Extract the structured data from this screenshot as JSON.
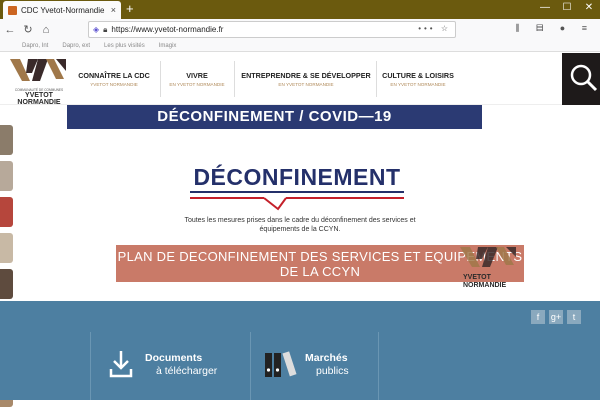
{
  "browser": {
    "tab_title": "CDC Yvetot-Normandie",
    "tab_close": "×",
    "new_tab": "+",
    "url": "https://www.yvetot-normandie.fr",
    "url_actions": "••• ☆",
    "window_controls": [
      "—",
      "☐",
      "✕"
    ],
    "nav_icons": [
      "←",
      "↻",
      "⌂"
    ],
    "bookmarks": [
      "Dapro, Int",
      "Dapro, ext",
      "Les plus visités",
      "Imagix"
    ],
    "colors": {
      "titlebar": "#6b5a0e"
    }
  },
  "header": {
    "logo": {
      "text_top": "COMMUNAUTÉ DE COMMUNES",
      "text_bottom_1": "YVETOT",
      "text_bottom_2": "NORMANDIE"
    },
    "menu": [
      {
        "title": "CONNAÎTRE LA CDC",
        "subtitle": "YVETOT NORMANDIE"
      },
      {
        "title": "VIVRE",
        "subtitle": "EN YVETOT NORMANDIE"
      },
      {
        "title": "ENTREPRENDRE & SE DÉVELOPPER",
        "subtitle": "EN YVETOT NORMANDIE"
      },
      {
        "title": "CULTURE & LOISIRS",
        "subtitle": "EN YVETOT NORMANDIE"
      }
    ]
  },
  "main": {
    "banner_title": "DÉCONFINEMENT / COVID—19",
    "deco_title": "DÉCONFINEMENT",
    "description": "Toutes les mesures prises dans le cadre du déconfinement des services et équipements de la CCYN.",
    "plan_title": "PLAN DE DECONFINEMENT DES SERVICES ET EQUIPEMENTS DE LA CCYN",
    "logo2": {
      "text_1": "YVETOT",
      "text_2": "NORMANDIE"
    }
  },
  "footer": {
    "social": [
      "f",
      "g+",
      "t"
    ],
    "links": [
      {
        "label_1": "Documents",
        "label_2": "à télécharger"
      },
      {
        "label_1": "Marchés",
        "label_2": "publics"
      }
    ]
  },
  "colors": {
    "navy": "#2b3a73",
    "terracotta": "#c97a68",
    "footer": "#4d7fa1",
    "brand_red": "#c4202a"
  }
}
